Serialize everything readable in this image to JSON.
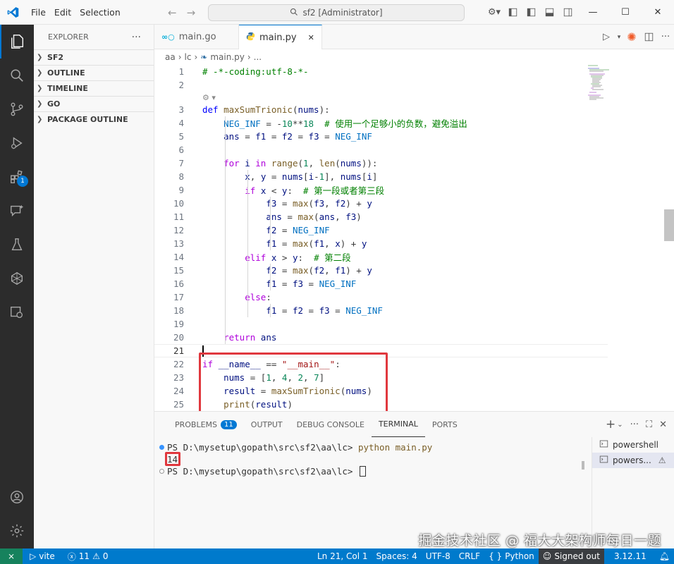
{
  "titlebar": {
    "menus": [
      "File",
      "Edit",
      "Selection"
    ],
    "search_text": "sf2 [Administrator]"
  },
  "activity": {
    "extensions_badge": "1"
  },
  "sidebar": {
    "title": "EXPLORER",
    "more": "···",
    "sections": [
      "SF2",
      "OUTLINE",
      "TIMELINE",
      "GO",
      "PACKAGE OUTLINE"
    ]
  },
  "tabs": [
    {
      "label": "main.go",
      "active": false
    },
    {
      "label": "main.py",
      "active": true
    }
  ],
  "breadcrumb": [
    "aa",
    "lc",
    "main.py",
    "..."
  ],
  "editor": {
    "lines": [
      {
        "n": "1",
        "code": "# -*-coding:utf-8-*-"
      },
      {
        "n": "2",
        "code": ""
      },
      {
        "n": "3",
        "code": "def maxSumTrionic(nums):"
      },
      {
        "n": "4",
        "code": "    NEG_INF = -10**18  # 使用一个足够小的负数，避免溢出"
      },
      {
        "n": "5",
        "code": "    ans = f1 = f2 = f3 = NEG_INF"
      },
      {
        "n": "6",
        "code": ""
      },
      {
        "n": "7",
        "code": "    for i in range(1, len(nums)):"
      },
      {
        "n": "8",
        "code": "        x, y = nums[i-1], nums[i]"
      },
      {
        "n": "9",
        "code": "        if x < y:  # 第一段或者第三段"
      },
      {
        "n": "10",
        "code": "            f3 = max(f3, f2) + y"
      },
      {
        "n": "11",
        "code": "            ans = max(ans, f3)"
      },
      {
        "n": "12",
        "code": "            f2 = NEG_INF"
      },
      {
        "n": "13",
        "code": "            f1 = max(f1, x) + y"
      },
      {
        "n": "14",
        "code": "        elif x > y:  # 第二段"
      },
      {
        "n": "15",
        "code": "            f2 = max(f2, f1) + y"
      },
      {
        "n": "16",
        "code": "            f1 = f3 = NEG_INF"
      },
      {
        "n": "17",
        "code": "        else:"
      },
      {
        "n": "18",
        "code": "            f1 = f2 = f3 = NEG_INF"
      },
      {
        "n": "19",
        "code": ""
      },
      {
        "n": "20",
        "code": "    return ans"
      },
      {
        "n": "21",
        "code": ""
      },
      {
        "n": "22",
        "code": "if __name__ == \"__main__\":"
      },
      {
        "n": "23",
        "code": "    nums = [1, 4, 2, 7]"
      },
      {
        "n": "24",
        "code": "    result = maxSumTrionic(nums)"
      },
      {
        "n": "25",
        "code": "    print(result)"
      }
    ]
  },
  "panel": {
    "tabs": [
      "PROBLEMS",
      "OUTPUT",
      "DEBUG CONSOLE",
      "TERMINAL",
      "PORTS"
    ],
    "problems_count": "11",
    "active_tab": "TERMINAL",
    "terminal_lines": [
      "PS D:\\mysetup\\gopath\\src\\sf2\\aa\\lc> ",
      "14",
      "PS D:\\mysetup\\gopath\\src\\sf2\\aa\\lc> "
    ],
    "command": "python main.py",
    "terminals": [
      "powershell",
      "powers..."
    ]
  },
  "watermark": "掘金技术社区 @ 福大大架构师每日一题",
  "statusbar": {
    "vite": "vite",
    "errors": "11",
    "warnings": "0",
    "position": "Ln 21, Col 1",
    "spaces": "Spaces: 4",
    "encoding": "UTF-8",
    "eol": "CRLF",
    "language": "Python",
    "account": "Signed out",
    "version": "3.12.11"
  },
  "colors": {
    "accent": "#0078d4",
    "statusbar": "#007acc",
    "highlight_box": "#e0383e"
  }
}
